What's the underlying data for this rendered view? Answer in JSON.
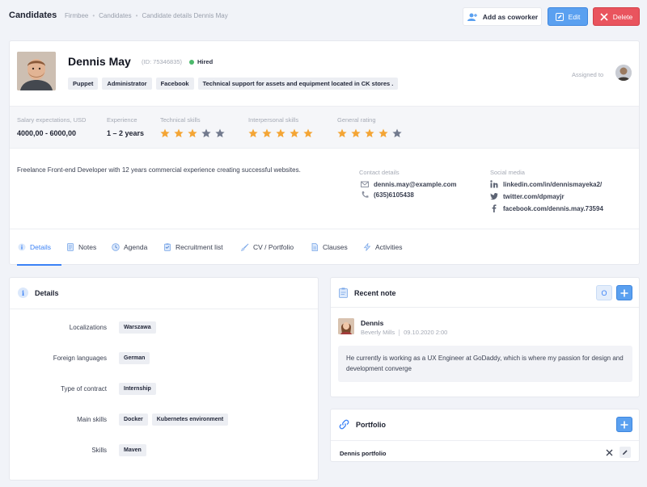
{
  "header": {
    "title": "Candidates",
    "breadcrumbs": [
      "Firmbee",
      "Candidates",
      "Candidate details Dennis May"
    ],
    "actions": {
      "coworker": "Add as coworker",
      "edit": "Edit",
      "delete": "Delete"
    }
  },
  "candidate": {
    "name": "Dennis May",
    "id": "(ID: 75346835)",
    "status": "Hired",
    "status_color": "#4cb96b",
    "tags": [
      "Puppet",
      "Administrator",
      "Facebook",
      "Technical support for assets and equipment located in CK stores ."
    ],
    "assigned_label": "Assigned to"
  },
  "stats": {
    "salary": {
      "label": "Salary expectations, USD",
      "value": "4000,00 - 6000,00"
    },
    "experience": {
      "label": "Experience",
      "value": "1 – 2 years"
    },
    "technical": {
      "label": "Technical skills",
      "rating": 3,
      "max": 5
    },
    "interpersonal": {
      "label": "Interpersonal skills",
      "rating": 5,
      "max": 5
    },
    "general": {
      "label": "General rating",
      "rating": 4,
      "max": 5
    }
  },
  "summary": "Freelance Front-end Developer with 12 years commercial experience creating successful websites.",
  "contact": {
    "title": "Contact details",
    "email": "dennis.may@example.com",
    "phone": "(635)6105438"
  },
  "social": {
    "title": "Social media",
    "linkedin": "linkedin.com/in/dennismayeka2/",
    "twitter": "twitter.com/dpmayjr",
    "facebook": "facebook.com/dennis.may.73594"
  },
  "tabs": [
    "Details",
    "Notes",
    "Agenda",
    "Recruitment list",
    "CV / Portfolio",
    "Clauses",
    "Activities"
  ],
  "details": {
    "title": "Details",
    "rows": [
      {
        "label": "Localizations",
        "values": [
          "Warszawa"
        ]
      },
      {
        "label": "Foreign languages",
        "values": [
          "German"
        ]
      },
      {
        "label": "Type of contract",
        "values": [
          "Internship"
        ]
      },
      {
        "label": "Main skills",
        "values": [
          "Docker",
          "Kubernetes environment"
        ]
      },
      {
        "label": "Skills",
        "values": [
          "Maven"
        ]
      }
    ]
  },
  "recent_note": {
    "title": "Recent note",
    "o_button": "O",
    "author": "Dennis",
    "location": "Beverly Mills",
    "date": "09.10.2020 2:00",
    "body": "He currently is working as a UX Engineer at GoDaddy, which is where my passion for design and development converge"
  },
  "portfolio": {
    "title": "Portfolio",
    "item": "Dennis portfolio"
  },
  "colors": {
    "accent": "#3b82f6",
    "danger": "#e9545e",
    "star_on": "#f4a535",
    "star_off": "#727a8e"
  }
}
